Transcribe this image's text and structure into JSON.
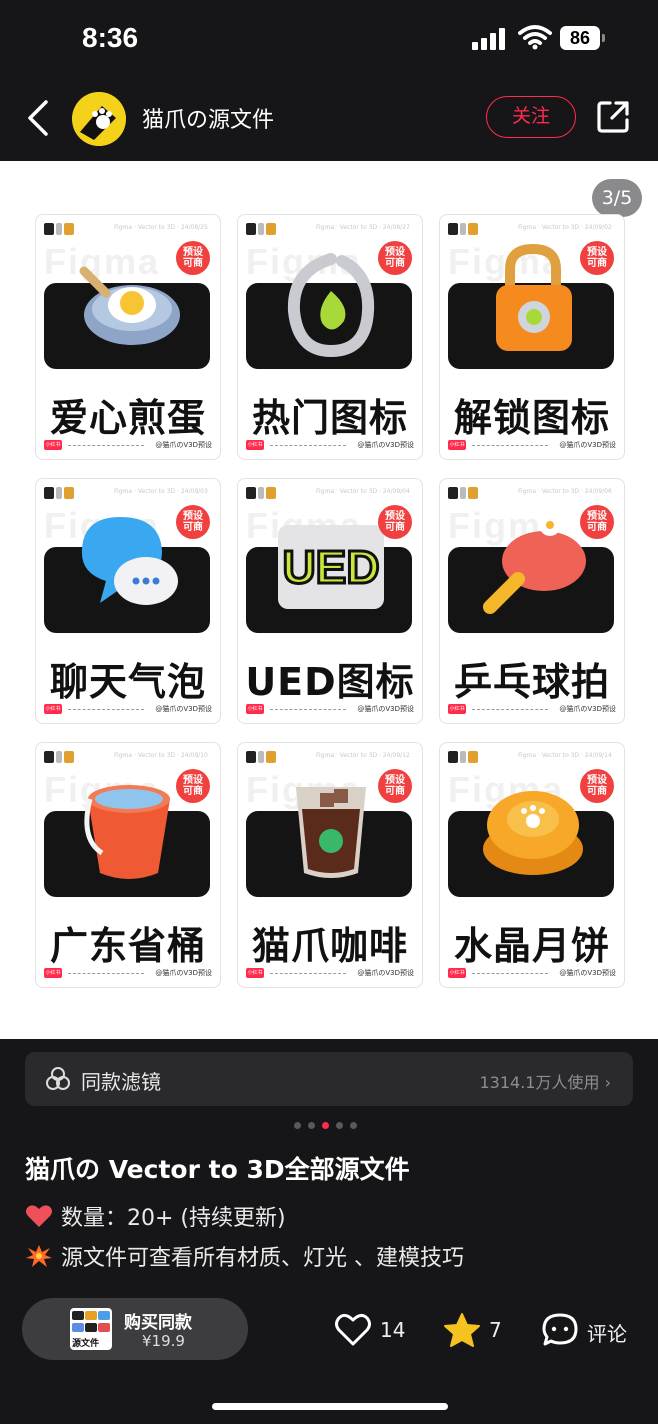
{
  "status_bar": {
    "time": "8:36",
    "battery": "86"
  },
  "header": {
    "author_name": "猫爪の源文件",
    "follow_label": "关注"
  },
  "image": {
    "pager": "3/5",
    "cards": [
      {
        "title": "爱心煎蛋",
        "meta": "Figma · Vector to 3D · 24/08/25"
      },
      {
        "title": "热门图标",
        "meta": "Figma · Vector to 3D · 24/08/27"
      },
      {
        "title": "解锁图标",
        "meta": "Figma · Vector to 3D · 24/09/02"
      },
      {
        "title": "聊天气泡",
        "meta": "Figma · Vector to 3D · 24/09/03"
      },
      {
        "title": "UED图标",
        "meta": "Figma · Vector to 3D · 24/09/04"
      },
      {
        "title": "乒乓球拍",
        "meta": "Figma · Vector to 3D · 24/09/06"
      },
      {
        "title": "广东省桶",
        "meta": "Figma · Vector to 3D · 24/09/10"
      },
      {
        "title": "猫爪咖啡",
        "meta": "Figma · Vector to 3D · 24/09/12"
      },
      {
        "title": "水晶月饼",
        "meta": "Figma · Vector to 3D · 24/09/14"
      }
    ],
    "badge": "预设\n可商",
    "footer_tag": "小红书",
    "footer_author": "@猫爪のV3D预设",
    "watermark": "Figma"
  },
  "filter": {
    "label": "同款滤镜",
    "count": "1314.1万人使用"
  },
  "post": {
    "title": "猫爪の Vector to 3D全部源文件",
    "lines": [
      "数量：20+ (持续更新)",
      "源文件可查看所有材质、灯光 、建模技巧"
    ]
  },
  "bottom": {
    "buy_label": "购买同款",
    "buy_price": "¥19.9",
    "thumb_caption": "源文件",
    "likes": "14",
    "stars": "7",
    "comment_label": "评论"
  },
  "colors": {
    "accent": "#ff2b4c",
    "bg": "#161618"
  }
}
